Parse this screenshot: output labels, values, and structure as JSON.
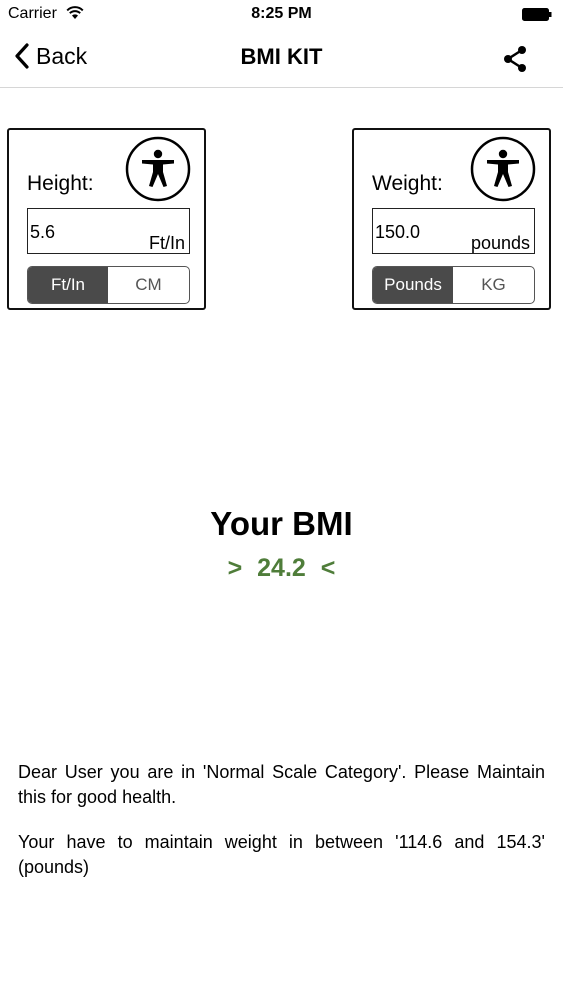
{
  "status_bar": {
    "carrier": "Carrier",
    "time": "8:25 PM"
  },
  "nav": {
    "back_label": "Back",
    "title": "BMI KIT"
  },
  "height_card": {
    "label": "Height:",
    "value": "5.6",
    "unit": "Ft/In",
    "options": [
      "Ft/In",
      "CM"
    ],
    "selected": "Ft/In"
  },
  "weight_card": {
    "label": "Weight:",
    "value": "150.0",
    "unit": "pounds",
    "options": [
      "Pounds",
      "KG"
    ],
    "selected": "Pounds"
  },
  "result": {
    "title": "Your BMI",
    "left_marker": ">",
    "value": "24.2",
    "right_marker": "<",
    "value_color": "#4f7d3a"
  },
  "messages": {
    "category": "Dear User you are in 'Normal Scale Category'. Please Maintain this for good health.",
    "weight_range": "Your have to maintain weight in between '114.6 and 154.3' (pounds)"
  }
}
